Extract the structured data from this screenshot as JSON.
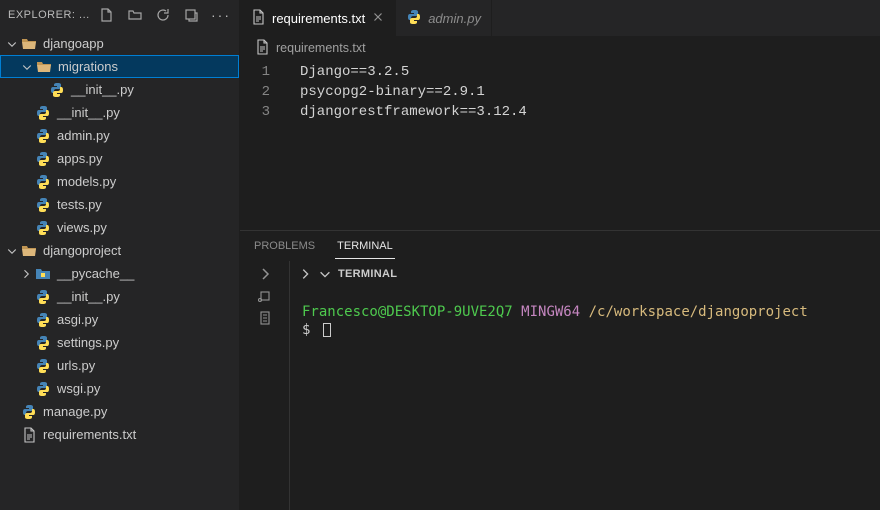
{
  "explorer": {
    "title": "EXPLORER: ..."
  },
  "tree": [
    {
      "type": "folder",
      "label": "djangoapp",
      "indent": 0,
      "expanded": true,
      "icon": "folder-open",
      "selected": false
    },
    {
      "type": "folder",
      "label": "migrations",
      "indent": 1,
      "expanded": true,
      "icon": "folder-open",
      "selected": true
    },
    {
      "type": "file",
      "label": "__init__.py",
      "indent": 2,
      "icon": "python"
    },
    {
      "type": "file",
      "label": "__init__.py",
      "indent": 1,
      "icon": "python"
    },
    {
      "type": "file",
      "label": "admin.py",
      "indent": 1,
      "icon": "python"
    },
    {
      "type": "file",
      "label": "apps.py",
      "indent": 1,
      "icon": "python"
    },
    {
      "type": "file",
      "label": "models.py",
      "indent": 1,
      "icon": "python"
    },
    {
      "type": "file",
      "label": "tests.py",
      "indent": 1,
      "icon": "python"
    },
    {
      "type": "file",
      "label": "views.py",
      "indent": 1,
      "icon": "python"
    },
    {
      "type": "folder",
      "label": "djangoproject",
      "indent": 0,
      "expanded": true,
      "icon": "folder-open",
      "selected": false
    },
    {
      "type": "folder",
      "label": "__pycache__",
      "indent": 1,
      "expanded": false,
      "icon": "folder-pycache",
      "selected": false
    },
    {
      "type": "file",
      "label": "__init__.py",
      "indent": 1,
      "icon": "python"
    },
    {
      "type": "file",
      "label": "asgi.py",
      "indent": 1,
      "icon": "python"
    },
    {
      "type": "file",
      "label": "settings.py",
      "indent": 1,
      "icon": "python"
    },
    {
      "type": "file",
      "label": "urls.py",
      "indent": 1,
      "icon": "python"
    },
    {
      "type": "file",
      "label": "wsgi.py",
      "indent": 1,
      "icon": "python"
    },
    {
      "type": "file",
      "label": "manage.py",
      "indent": 0,
      "icon": "python"
    },
    {
      "type": "file",
      "label": "requirements.txt",
      "indent": 0,
      "icon": "text"
    }
  ],
  "tabs": [
    {
      "label": "requirements.txt",
      "icon": "text",
      "active": true,
      "italic": false
    },
    {
      "label": "admin.py",
      "icon": "python",
      "active": false,
      "italic": true
    }
  ],
  "breadcrumb": {
    "icon": "text",
    "label": "requirements.txt"
  },
  "editor": {
    "lines": [
      {
        "num": "1",
        "text": "Django==3.2.5"
      },
      {
        "num": "2",
        "text": "psycopg2-binary==2.9.1"
      },
      {
        "num": "3",
        "text": "djangorestframework==3.12.4"
      }
    ]
  },
  "panel": {
    "tabs": {
      "problems": "PROBLEMS",
      "terminal": "TERMINAL"
    },
    "terminal_label": "TERMINAL",
    "prompt": {
      "user": "Francesco@DESKTOP-9UVE2Q7",
      "sys": "MINGW64",
      "path": "/c/workspace/djangoproject",
      "ps": "$"
    }
  }
}
